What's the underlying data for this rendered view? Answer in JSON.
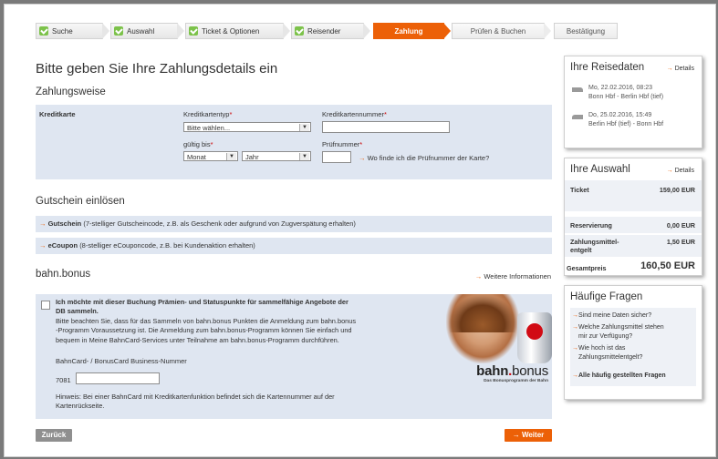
{
  "steps": [
    {
      "label": "Suche",
      "state": "done"
    },
    {
      "label": "Auswahl",
      "state": "done"
    },
    {
      "label": "Ticket & Optionen",
      "state": "done"
    },
    {
      "label": "Reisender",
      "state": "done"
    },
    {
      "label": "Zahlung",
      "state": "active"
    },
    {
      "label": "Prüfen & Buchen",
      "state": "future"
    },
    {
      "label": "Bestätigung",
      "state": "future"
    }
  ],
  "main": {
    "title": "Bitte geben Sie Ihre Zahlungsdetails ein",
    "payment_heading": "Zahlungsweise",
    "payment": {
      "method_label": "Kreditkarte",
      "card_type_label": "Kreditkartentyp",
      "card_type_value": "Bitte wählen...",
      "card_number_label": "Kreditkartennummer",
      "card_number_value": "",
      "valid_until_label": "gültig bis",
      "month_value": "Monat",
      "year_value": "Jahr",
      "cvc_label": "Prüfnummer",
      "cvc_value": "",
      "cvc_help": "Wo finde ich die Prüfnummer der Karte?",
      "required_mark": "*"
    },
    "voucher_heading": "Gutschein einlösen",
    "voucher": {
      "gutschein_label": "Gutschein",
      "gutschein_desc": "(7-stelliger Gutscheincode, z.B. als Geschenk oder aufgrund von Zugverspätung erhalten)",
      "ecoupon_label": "eCoupon",
      "ecoupon_desc": "(8-stelliger eCouponcode, z.B. bei Kundenaktion erhalten)"
    },
    "bonus_heading": "bahn.bonus",
    "bonus_more": "Weitere Informationen",
    "bonus": {
      "checkbox_title_1": "Ich möchte mit dieser Buchung Prämien- und Statuspunkte für sammelfähige Angebote der",
      "checkbox_title_2": "DB sammeln.",
      "text_1": "Bitte beachten Sie, dass für das Sammeln von bahn.bonus Punkten die Anmeldung zum bahn.bonus",
      "text_2": "-Programm Voraussetzung ist. Die Anmeldung zum bahn.bonus-Programm können Sie einfach und",
      "text_3": "bequem in Meine BahnCard-Services unter Teilnahme am bahn.bonus-Programm durchführen.",
      "card_label": "BahnCard- / BonusCard Business-Nummer",
      "card_prefix": "7081",
      "card_value": "",
      "hint_1": "Hinweis: Bei einer BahnCard mit Kreditkartenfunktion befindet sich die Kartennummer auf der",
      "hint_2": "Kartenrückseite.",
      "logo_word_a": "bahn",
      "logo_dot": ".",
      "logo_word_b": "bonus",
      "logo_sub": "Das Bonusprogramm der Bahn"
    },
    "back_label": "Zurück",
    "next_label": "Weiter"
  },
  "sidebar": {
    "travel": {
      "title": "Ihre Reisedaten",
      "details": "Details",
      "legs": [
        {
          "date": "Mo, 22.02.2016, 08:23",
          "route": "Bonn Hbf - Berlin Hbf (tief)"
        },
        {
          "date": "Do, 25.02.2016, 15:49",
          "route": "Berlin Hbf (tief) - Bonn Hbf"
        }
      ]
    },
    "selection": {
      "title": "Ihre Auswahl",
      "details": "Details",
      "ticket_label": "Ticket",
      "ticket_value": "159,00 EUR",
      "reservation_label": "Reservierung",
      "reservation_value": "0,00 EUR",
      "fee_label_1": "Zahlungsmittel-",
      "fee_label_2": "entgelt",
      "fee_value": "1,50 EUR",
      "total_label": "Gesamtpreis",
      "total_value": "160,50 EUR"
    },
    "faq": {
      "title": "Häufige Fragen",
      "items": [
        [
          "Sind meine Daten sicher?"
        ],
        [
          "Welche Zahlungsmittel stehen",
          "mir zur Verfügung?"
        ],
        [
          "Wie hoch ist das",
          "Zahlungsmittelentgelt?"
        ]
      ],
      "all_label": "Alle häufig gestellten Fragen"
    }
  },
  "colors": {
    "accent": "#ec6007",
    "panel": "#dfe6f1",
    "check": "#7cc24a"
  }
}
